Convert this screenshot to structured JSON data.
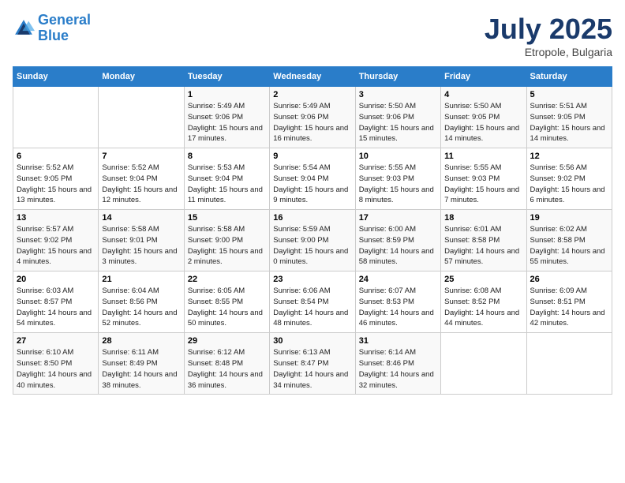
{
  "header": {
    "logo_line1": "General",
    "logo_line2": "Blue",
    "month": "July 2025",
    "location": "Etropole, Bulgaria"
  },
  "weekdays": [
    "Sunday",
    "Monday",
    "Tuesday",
    "Wednesday",
    "Thursday",
    "Friday",
    "Saturday"
  ],
  "weeks": [
    [
      {
        "day": "",
        "sunrise": "",
        "sunset": "",
        "daylight": ""
      },
      {
        "day": "",
        "sunrise": "",
        "sunset": "",
        "daylight": ""
      },
      {
        "day": "1",
        "sunrise": "Sunrise: 5:49 AM",
        "sunset": "Sunset: 9:06 PM",
        "daylight": "Daylight: 15 hours and 17 minutes."
      },
      {
        "day": "2",
        "sunrise": "Sunrise: 5:49 AM",
        "sunset": "Sunset: 9:06 PM",
        "daylight": "Daylight: 15 hours and 16 minutes."
      },
      {
        "day": "3",
        "sunrise": "Sunrise: 5:50 AM",
        "sunset": "Sunset: 9:06 PM",
        "daylight": "Daylight: 15 hours and 15 minutes."
      },
      {
        "day": "4",
        "sunrise": "Sunrise: 5:50 AM",
        "sunset": "Sunset: 9:05 PM",
        "daylight": "Daylight: 15 hours and 14 minutes."
      },
      {
        "day": "5",
        "sunrise": "Sunrise: 5:51 AM",
        "sunset": "Sunset: 9:05 PM",
        "daylight": "Daylight: 15 hours and 14 minutes."
      }
    ],
    [
      {
        "day": "6",
        "sunrise": "Sunrise: 5:52 AM",
        "sunset": "Sunset: 9:05 PM",
        "daylight": "Daylight: 15 hours and 13 minutes."
      },
      {
        "day": "7",
        "sunrise": "Sunrise: 5:52 AM",
        "sunset": "Sunset: 9:04 PM",
        "daylight": "Daylight: 15 hours and 12 minutes."
      },
      {
        "day": "8",
        "sunrise": "Sunrise: 5:53 AM",
        "sunset": "Sunset: 9:04 PM",
        "daylight": "Daylight: 15 hours and 11 minutes."
      },
      {
        "day": "9",
        "sunrise": "Sunrise: 5:54 AM",
        "sunset": "Sunset: 9:04 PM",
        "daylight": "Daylight: 15 hours and 9 minutes."
      },
      {
        "day": "10",
        "sunrise": "Sunrise: 5:55 AM",
        "sunset": "Sunset: 9:03 PM",
        "daylight": "Daylight: 15 hours and 8 minutes."
      },
      {
        "day": "11",
        "sunrise": "Sunrise: 5:55 AM",
        "sunset": "Sunset: 9:03 PM",
        "daylight": "Daylight: 15 hours and 7 minutes."
      },
      {
        "day": "12",
        "sunrise": "Sunrise: 5:56 AM",
        "sunset": "Sunset: 9:02 PM",
        "daylight": "Daylight: 15 hours and 6 minutes."
      }
    ],
    [
      {
        "day": "13",
        "sunrise": "Sunrise: 5:57 AM",
        "sunset": "Sunset: 9:02 PM",
        "daylight": "Daylight: 15 hours and 4 minutes."
      },
      {
        "day": "14",
        "sunrise": "Sunrise: 5:58 AM",
        "sunset": "Sunset: 9:01 PM",
        "daylight": "Daylight: 15 hours and 3 minutes."
      },
      {
        "day": "15",
        "sunrise": "Sunrise: 5:58 AM",
        "sunset": "Sunset: 9:00 PM",
        "daylight": "Daylight: 15 hours and 2 minutes."
      },
      {
        "day": "16",
        "sunrise": "Sunrise: 5:59 AM",
        "sunset": "Sunset: 9:00 PM",
        "daylight": "Daylight: 15 hours and 0 minutes."
      },
      {
        "day": "17",
        "sunrise": "Sunrise: 6:00 AM",
        "sunset": "Sunset: 8:59 PM",
        "daylight": "Daylight: 14 hours and 58 minutes."
      },
      {
        "day": "18",
        "sunrise": "Sunrise: 6:01 AM",
        "sunset": "Sunset: 8:58 PM",
        "daylight": "Daylight: 14 hours and 57 minutes."
      },
      {
        "day": "19",
        "sunrise": "Sunrise: 6:02 AM",
        "sunset": "Sunset: 8:58 PM",
        "daylight": "Daylight: 14 hours and 55 minutes."
      }
    ],
    [
      {
        "day": "20",
        "sunrise": "Sunrise: 6:03 AM",
        "sunset": "Sunset: 8:57 PM",
        "daylight": "Daylight: 14 hours and 54 minutes."
      },
      {
        "day": "21",
        "sunrise": "Sunrise: 6:04 AM",
        "sunset": "Sunset: 8:56 PM",
        "daylight": "Daylight: 14 hours and 52 minutes."
      },
      {
        "day": "22",
        "sunrise": "Sunrise: 6:05 AM",
        "sunset": "Sunset: 8:55 PM",
        "daylight": "Daylight: 14 hours and 50 minutes."
      },
      {
        "day": "23",
        "sunrise": "Sunrise: 6:06 AM",
        "sunset": "Sunset: 8:54 PM",
        "daylight": "Daylight: 14 hours and 48 minutes."
      },
      {
        "day": "24",
        "sunrise": "Sunrise: 6:07 AM",
        "sunset": "Sunset: 8:53 PM",
        "daylight": "Daylight: 14 hours and 46 minutes."
      },
      {
        "day": "25",
        "sunrise": "Sunrise: 6:08 AM",
        "sunset": "Sunset: 8:52 PM",
        "daylight": "Daylight: 14 hours and 44 minutes."
      },
      {
        "day": "26",
        "sunrise": "Sunrise: 6:09 AM",
        "sunset": "Sunset: 8:51 PM",
        "daylight": "Daylight: 14 hours and 42 minutes."
      }
    ],
    [
      {
        "day": "27",
        "sunrise": "Sunrise: 6:10 AM",
        "sunset": "Sunset: 8:50 PM",
        "daylight": "Daylight: 14 hours and 40 minutes."
      },
      {
        "day": "28",
        "sunrise": "Sunrise: 6:11 AM",
        "sunset": "Sunset: 8:49 PM",
        "daylight": "Daylight: 14 hours and 38 minutes."
      },
      {
        "day": "29",
        "sunrise": "Sunrise: 6:12 AM",
        "sunset": "Sunset: 8:48 PM",
        "daylight": "Daylight: 14 hours and 36 minutes."
      },
      {
        "day": "30",
        "sunrise": "Sunrise: 6:13 AM",
        "sunset": "Sunset: 8:47 PM",
        "daylight": "Daylight: 14 hours and 34 minutes."
      },
      {
        "day": "31",
        "sunrise": "Sunrise: 6:14 AM",
        "sunset": "Sunset: 8:46 PM",
        "daylight": "Daylight: 14 hours and 32 minutes."
      },
      {
        "day": "",
        "sunrise": "",
        "sunset": "",
        "daylight": ""
      },
      {
        "day": "",
        "sunrise": "",
        "sunset": "",
        "daylight": ""
      }
    ]
  ]
}
